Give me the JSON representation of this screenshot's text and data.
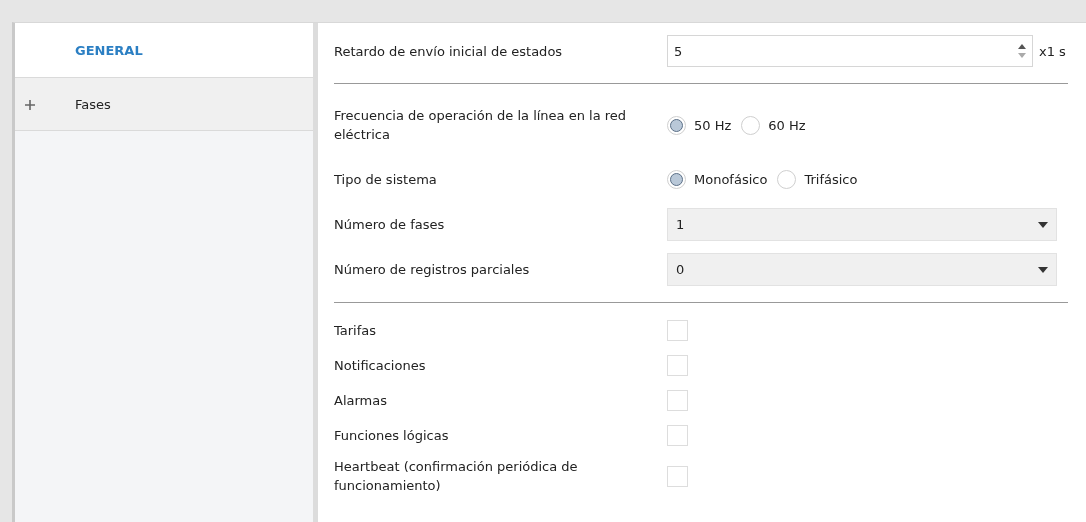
{
  "sidebar": {
    "items": [
      {
        "label": "GENERAL",
        "selected": true,
        "expandable": false
      },
      {
        "label": "Fases",
        "selected": false,
        "expandable": true
      }
    ]
  },
  "settings": [
    {
      "kind": "spin",
      "label": "Retardo de envío inicial de estados",
      "value": "5",
      "unit": "x1 s"
    },
    {
      "kind": "divider"
    },
    {
      "kind": "radio",
      "label": "Frecuencia de operación de la línea en la red eléctrica",
      "options": [
        {
          "label": "50 Hz",
          "selected": true
        },
        {
          "label": "60 Hz",
          "selected": false
        }
      ]
    },
    {
      "kind": "radio",
      "label": "Tipo de sistema",
      "options": [
        {
          "label": "Monofásico",
          "selected": true
        },
        {
          "label": "Trifásico",
          "selected": false
        }
      ]
    },
    {
      "kind": "select",
      "label": "Número de fases",
      "value": "1"
    },
    {
      "kind": "select",
      "label": "Número de registros parciales",
      "value": "0"
    },
    {
      "kind": "divider"
    },
    {
      "kind": "checkbox",
      "label": "Tarifas",
      "checked": false
    },
    {
      "kind": "checkbox",
      "label": "Notificaciones",
      "checked": false
    },
    {
      "kind": "checkbox",
      "label": "Alarmas",
      "checked": false
    },
    {
      "kind": "checkbox",
      "label": "Funciones lógicas",
      "checked": false
    },
    {
      "kind": "checkbox",
      "label": "Heartbeat (confirmación periódica de funcionamiento)",
      "checked": false
    }
  ]
}
